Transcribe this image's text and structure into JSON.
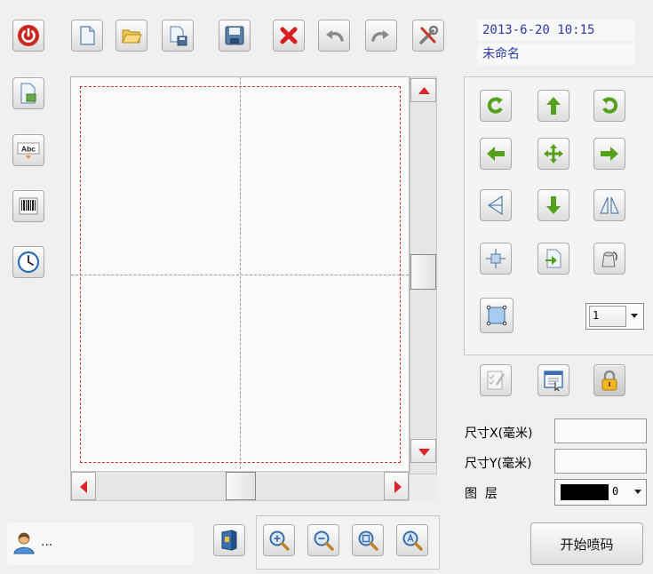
{
  "header": {
    "datetime": "2013-6-20 10:15",
    "filename": "未命名"
  },
  "toolbar": {
    "items": [
      "power-icon",
      "new-file-icon",
      "open-folder-icon",
      "save-as-icon",
      "save-icon",
      "delete-icon",
      "undo-icon",
      "redo-icon",
      "settings-icon"
    ]
  },
  "left_tools": [
    "insert-image-icon",
    "insert-text-icon",
    "insert-barcode-icon",
    "insert-clock-icon"
  ],
  "left_tool_labels": {
    "text": "Abc"
  },
  "layer": {
    "selected": "1"
  },
  "props": {
    "size_x_label": "尺寸X(毫米)",
    "size_y_label": "尺寸Y(毫米)",
    "layer_label": "图  层",
    "layer_value": "0",
    "layer_color": "#000000"
  },
  "user": {
    "name": "..."
  },
  "zoom": [
    "zoom-in-icon",
    "zoom-out-icon",
    "zoom-fit-icon",
    "zoom-reset-icon"
  ],
  "actions": {
    "start_print": "开始喷码"
  },
  "colors": {
    "power": "#cc2222",
    "arrow_green": "#55a01c",
    "delete_red": "#d62020",
    "guide_red": "#d23232"
  }
}
